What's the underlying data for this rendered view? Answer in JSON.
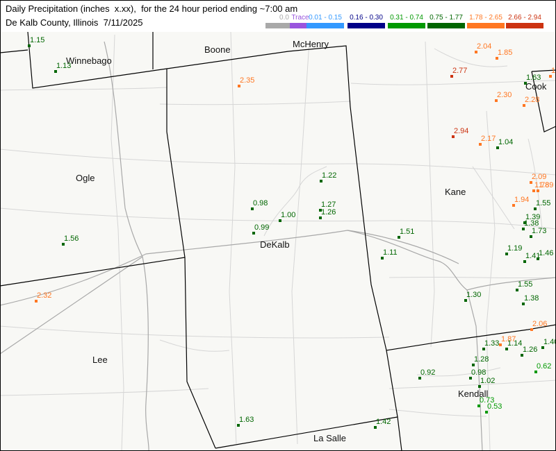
{
  "header": {
    "title": "Daily Precipitation (inches  x.xx),  for the 24 hour period ending ~7:00 am",
    "subtitle": "De Kalb County, Illinois  7/11/2025"
  },
  "legend": [
    {
      "label": "0.0",
      "color": "#a9a9a9"
    },
    {
      "label": "Trace",
      "color": "#9955dd"
    },
    {
      "label": "0.01 - 0.15",
      "color": "#3399ff"
    },
    {
      "label": "0.16 - 0.30",
      "color": "#000088"
    },
    {
      "label": "0.31 - 0.74",
      "color": "#009900"
    },
    {
      "label": "0.75 - 1.77",
      "color": "#006600"
    },
    {
      "label": "1.78 - 2.65",
      "color": "#ff7722"
    },
    {
      "label": "2.66 - 2.94",
      "color": "#cc3311"
    }
  ],
  "counties": [
    "Winnebago",
    "Boone",
    "McHenry",
    "Ogle",
    "DeKalb",
    "Kane",
    "Cook",
    "Lee",
    "Kendall",
    "La Salle"
  ],
  "stations": [
    {
      "value": "1.15",
      "color": "#006600"
    },
    {
      "value": "1.13",
      "color": "#006600"
    },
    {
      "value": "2.35",
      "color": "#ff7722"
    },
    {
      "value": "2.04",
      "color": "#ff7722"
    },
    {
      "value": "1.85",
      "color": "#ff7722"
    },
    {
      "value": "2.77",
      "color": "#cc3311"
    },
    {
      "value": "1.63",
      "color": "#006600"
    },
    {
      "value": "1",
      "color": "#ff7722"
    },
    {
      "value": "2.30",
      "color": "#ff7722"
    },
    {
      "value": "2.28",
      "color": "#ff7722"
    },
    {
      "value": "2.94",
      "color": "#cc3311"
    },
    {
      "value": "2.17",
      "color": "#ff7722"
    },
    {
      "value": "1.04",
      "color": "#006600"
    },
    {
      "value": "1.22",
      "color": "#006600"
    },
    {
      "value": "2.09",
      "color": "#ff7722"
    },
    {
      "value": "1.78",
      "color": "#ff7722"
    },
    {
      "value": "1.89",
      "color": "#ff7722"
    },
    {
      "value": "0.98",
      "color": "#006600"
    },
    {
      "value": "1.27",
      "color": "#006600"
    },
    {
      "value": "1.26",
      "color": "#006600"
    },
    {
      "value": "1.00",
      "color": "#006600"
    },
    {
      "value": "0.99",
      "color": "#006600"
    },
    {
      "value": "1.94",
      "color": "#ff7722"
    },
    {
      "value": "1.55",
      "color": "#006600"
    },
    {
      "value": "1.39",
      "color": "#006600"
    },
    {
      "value": "1.38",
      "color": "#006600"
    },
    {
      "value": "1.73",
      "color": "#006600"
    },
    {
      "value": "1.56",
      "color": "#006600"
    },
    {
      "value": "1.51",
      "color": "#006600"
    },
    {
      "value": "1.11",
      "color": "#006600"
    },
    {
      "value": "1.19",
      "color": "#006600"
    },
    {
      "value": "1.41",
      "color": "#006600"
    },
    {
      "value": "1.46",
      "color": "#006600"
    },
    {
      "value": "2.32",
      "color": "#ff7722"
    },
    {
      "value": "1.55",
      "color": "#006600"
    },
    {
      "value": "1.30",
      "color": "#006600"
    },
    {
      "value": "1.38",
      "color": "#006600"
    },
    {
      "value": "2.06",
      "color": "#ff7722"
    },
    {
      "value": "1.87",
      "color": "#ff7722"
    },
    {
      "value": "1.33",
      "color": "#006600"
    },
    {
      "value": "1.14",
      "color": "#006600"
    },
    {
      "value": "1.40",
      "color": "#006600"
    },
    {
      "value": "1.26",
      "color": "#006600"
    },
    {
      "value": "1.28",
      "color": "#006600"
    },
    {
      "value": "0.62",
      "color": "#009900"
    },
    {
      "value": "0.92",
      "color": "#006600"
    },
    {
      "value": "0.98",
      "color": "#006600"
    },
    {
      "value": "1.02",
      "color": "#006600"
    },
    {
      "value": "0.73",
      "color": "#009900"
    },
    {
      "value": "0.53",
      "color": "#009900"
    },
    {
      "value": "1.63",
      "color": "#006600"
    },
    {
      "value": "1.42",
      "color": "#006600"
    }
  ]
}
